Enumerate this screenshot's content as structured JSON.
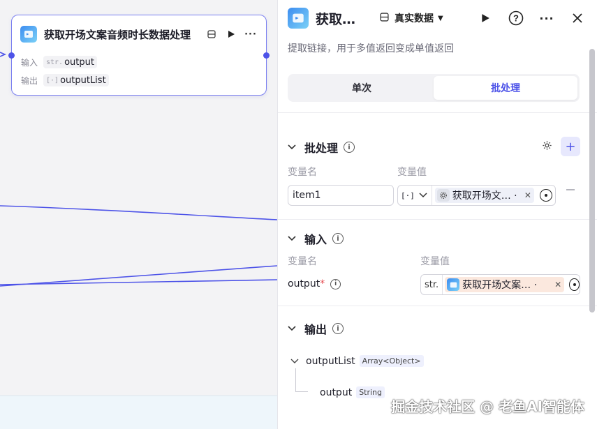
{
  "node": {
    "title": "获取开场文案音频时长数据处理",
    "input_label": "输入",
    "input_type": "str.",
    "input_value": "output",
    "output_label": "输出",
    "output_type": "[·]",
    "output_value": "outputList"
  },
  "panel": {
    "title": "获取…",
    "mode_label": "真实数据",
    "description": "提取链接，用于多值返回变成单值返回",
    "tabs": [
      {
        "label": "单次",
        "active": false
      },
      {
        "label": "批处理",
        "active": true
      }
    ],
    "batch": {
      "title": "批处理",
      "col_name": "变量名",
      "col_value": "变量值",
      "var_name": "item1",
      "var_type": "[·]",
      "ref_text": "获取开场文… ·"
    },
    "input": {
      "title": "输入",
      "col_name": "变量名",
      "col_value": "变量值",
      "var_name": "output",
      "required_mark": "*",
      "ref_type": "str.",
      "ref_text": "获取开场文案… ·"
    },
    "output": {
      "title": "输出",
      "items": [
        {
          "name": "outputList",
          "type": "Array<Object>"
        },
        {
          "name": "output",
          "type": "String"
        }
      ]
    }
  },
  "watermark": "掘金技术社区 @ 老鱼AI智能体",
  "colors": {
    "accent": "#4d53e8",
    "edge": "#4d53e8",
    "required": "#e5484d"
  }
}
